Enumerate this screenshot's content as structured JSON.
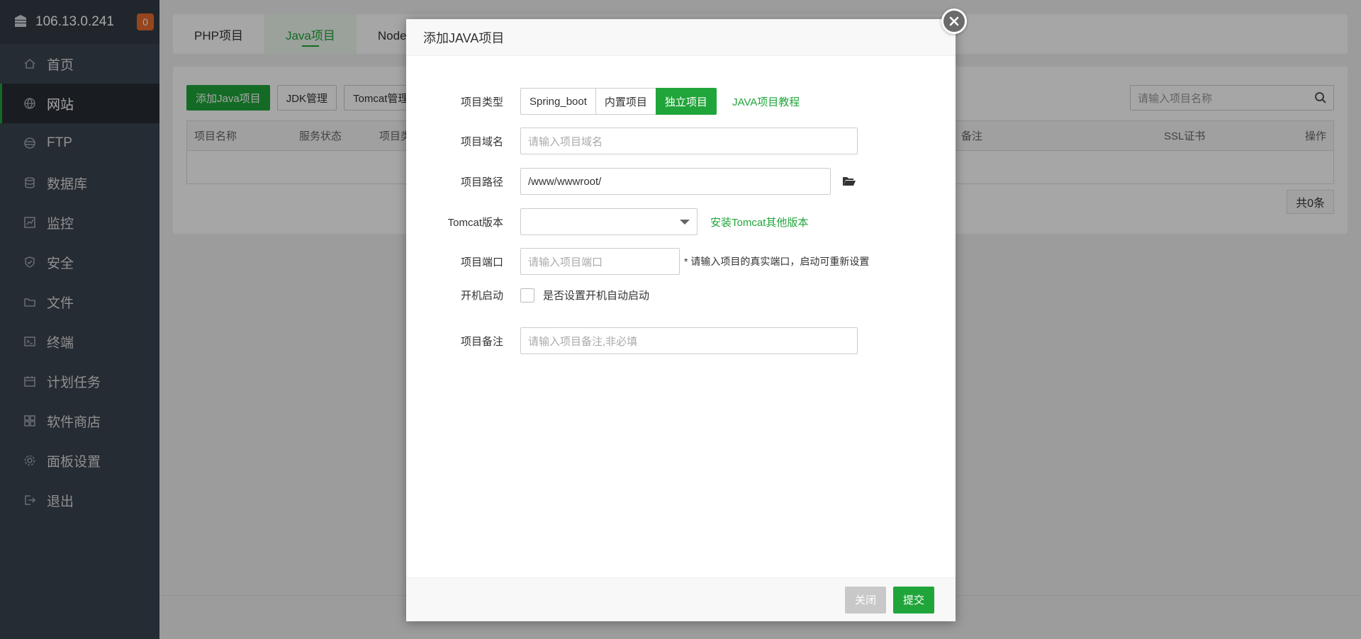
{
  "sidebar": {
    "ip": "106.13.0.241",
    "badge": "0",
    "items": [
      {
        "label": "首页",
        "icon": "home-icon"
      },
      {
        "label": "网站",
        "icon": "globe-icon"
      },
      {
        "label": "FTP",
        "icon": "ftp-icon"
      },
      {
        "label": "数据库",
        "icon": "database-icon"
      },
      {
        "label": "监控",
        "icon": "monitor-icon"
      },
      {
        "label": "安全",
        "icon": "shield-icon"
      },
      {
        "label": "文件",
        "icon": "folder-icon"
      },
      {
        "label": "终端",
        "icon": "terminal-icon"
      },
      {
        "label": "计划任务",
        "icon": "calendar-icon"
      },
      {
        "label": "软件商店",
        "icon": "apps-icon"
      },
      {
        "label": "面板设置",
        "icon": "gear-icon"
      },
      {
        "label": "退出",
        "icon": "logout-icon"
      }
    ]
  },
  "tabs": [
    {
      "label": "PHP项目"
    },
    {
      "label": "Java项目"
    },
    {
      "label": "Node项目"
    }
  ],
  "toolbar": {
    "add_java": "添加Java项目",
    "jdk": "JDK管理",
    "tomcat": "Tomcat管理"
  },
  "search": {
    "placeholder": "请输入项目名称"
  },
  "table": {
    "headers": [
      "项目名称",
      "服务状态",
      "项目类型",
      "备注",
      "SSL证书",
      "操作"
    ]
  },
  "pager": {
    "total": "共0条"
  },
  "modal": {
    "title": "添加JAVA项目",
    "type_label": "项目类型",
    "type_options": [
      "Spring_boot",
      "内置项目",
      "独立项目"
    ],
    "type_selected": "独立项目",
    "tutorial_link": "JAVA项目教程",
    "domain_label": "项目域名",
    "domain_placeholder": "请输入项目域名",
    "path_label": "项目路径",
    "path_value": "/www/wwwroot/",
    "tomcat_label": "Tomcat版本",
    "tomcat_value": "",
    "install_tomcat_link": "安装Tomcat其他版本",
    "port_label": "项目端口",
    "port_placeholder": "请输入项目端口",
    "port_hint": "* 请输入项目的真实端口，启动可重新设置",
    "boot_label": "开机启动",
    "boot_checkbox_label": "是否设置开机自动启动",
    "boot_checked": false,
    "remark_label": "项目备注",
    "remark_placeholder": "请输入项目备注,非必填",
    "close_button": "关闭",
    "submit_button": "提交"
  },
  "colors": {
    "brand_green": "#20a53a",
    "sidebar_bg": "#3b4450",
    "badge_orange": "#e66a2b"
  }
}
